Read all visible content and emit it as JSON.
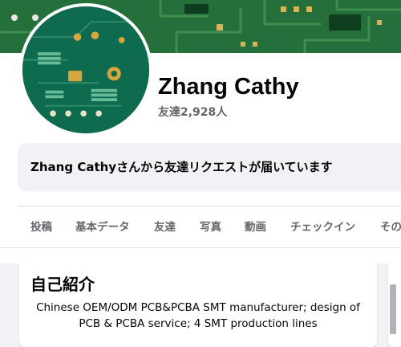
{
  "profile": {
    "name": "Zhang Cathy",
    "friends_count": "友達2,928人"
  },
  "friend_request": {
    "message": "Zhang Cathyさんから友達リクエストが届いています"
  },
  "tabs": [
    {
      "label": "投稿"
    },
    {
      "label": "基本データ"
    },
    {
      "label": "友達"
    },
    {
      "label": "写真"
    },
    {
      "label": "動画"
    },
    {
      "label": "チェックイン"
    },
    {
      "label": "その"
    }
  ],
  "intro": {
    "title": "自己紹介",
    "bio": "Chinese OEM/ODM PCB&PCBA SMT manufacturer; design of PCB & PCBA service; 4 SMT production lines"
  },
  "colors": {
    "page_background": "#f0f2f5",
    "pcb_green": "#1f6a35",
    "secondary_text": "#65676b"
  },
  "icons": {
    "cover": "pcb-cover-photo",
    "avatar": "pcb-avatar-photo"
  }
}
